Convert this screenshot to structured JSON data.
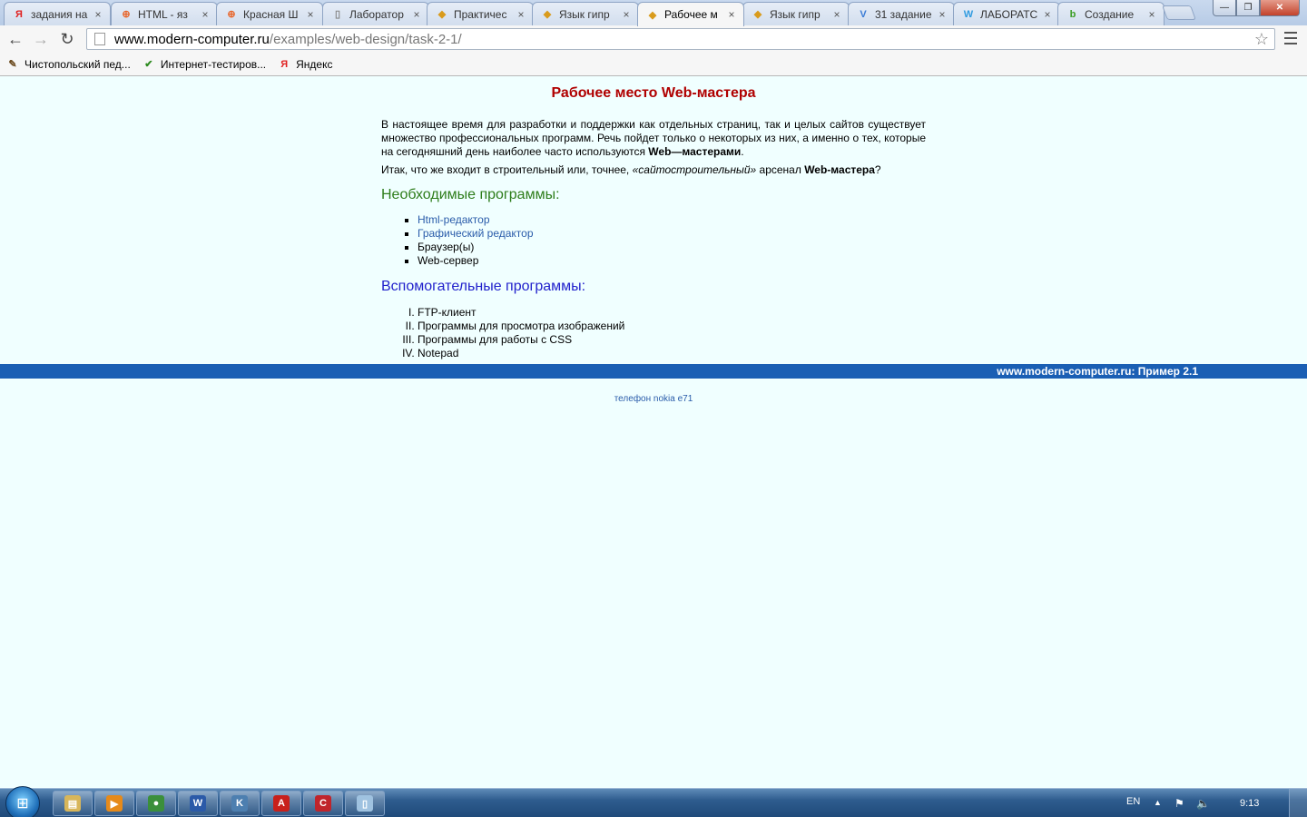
{
  "browser": {
    "tabs": [
      {
        "title": "задания на",
        "icon": "yandex-icon",
        "icon_char": "Я",
        "icon_color": "#e02020",
        "active": false
      },
      {
        "title": "HTML - яз",
        "icon": "lifebuoy-icon",
        "icon_char": "⊕",
        "icon_color": "#e8652a",
        "active": false
      },
      {
        "title": "Красная Ш",
        "icon": "lifebuoy-icon",
        "icon_char": "⊕",
        "icon_color": "#e8652a",
        "active": false
      },
      {
        "title": "Лаборатор",
        "icon": "blank-page-icon",
        "icon_char": "▯",
        "icon_color": "#888888",
        "active": false
      },
      {
        "title": "Практичес",
        "icon": "windows-logo-icon",
        "icon_char": "◆",
        "icon_color": "#d99b1c",
        "active": false
      },
      {
        "title": "Язык гипр",
        "icon": "windows-logo-icon",
        "icon_char": "◆",
        "icon_color": "#d99b1c",
        "active": false
      },
      {
        "title": "Рабочее м",
        "icon": "windows-logo-icon",
        "icon_char": "◆",
        "icon_color": "#d99b1c",
        "active": true
      },
      {
        "title": "Язык гипр",
        "icon": "windows-logo-icon",
        "icon_char": "◆",
        "icon_color": "#d99b1c",
        "active": false
      },
      {
        "title": "31 задание",
        "icon": "v-logo-icon",
        "icon_char": "V",
        "icon_color": "#3a7bd5",
        "active": false
      },
      {
        "title": "ЛАБОРАТС",
        "icon": "w-logo-icon",
        "icon_char": "W",
        "icon_color": "#2f9be0",
        "active": false
      },
      {
        "title": "Создание",
        "icon": "b-logo-icon",
        "icon_char": "b",
        "icon_color": "#3a9d23",
        "active": false
      }
    ],
    "tab_close_glyph": "×",
    "window_buttons": {
      "minimize": "—",
      "maximize": "❐",
      "close": "✕"
    },
    "nav": {
      "back": "←",
      "forward": "→",
      "reload": "↻"
    },
    "url": {
      "host": "www.modern-computer.ru",
      "path": "/examples/web-design/task-2-1/"
    },
    "bookmark_star": "☆",
    "bookmarks": [
      {
        "label": "Чистопольский пед...",
        "icon": "brush-icon",
        "icon_char": "✎",
        "icon_color": "#6b4a1e"
      },
      {
        "label": "Интернет-тестиров...",
        "icon": "green-check-icon",
        "icon_char": "✔",
        "icon_color": "#2d8a1f"
      },
      {
        "label": "Яндекс",
        "icon": "yandex-icon",
        "icon_char": "Я",
        "icon_color": "#e02020"
      }
    ]
  },
  "page": {
    "title": "Рабочее место Web-мастера",
    "intro_text": "В настоящее время для разработки и поддержки как отдельных страниц, так и целых сайтов существует множество профессиональных программ. Речь пойдет только о некоторых из них, а именно о тех, которые на сегодняшний день наиболее часто используются ",
    "intro_bold": "Web—мастерами",
    "intro_end": ".",
    "question_start": "Итак, что же входит в строительный или, точнее, ",
    "question_italic": "«сайтостроительный»",
    "question_mid": " арсенал ",
    "question_bold": "Web-мастера",
    "question_end": "?",
    "required_heading": "Необходимые программы:",
    "required_items": [
      {
        "label": "Html-редактор",
        "link": true
      },
      {
        "label": "Графический редактор",
        "link": true
      },
      {
        "label": "Браузер(ы)",
        "link": false
      },
      {
        "label": "Web-сервер",
        "link": false
      }
    ],
    "auxiliary_heading": "Вспомогательные программы:",
    "auxiliary_items": [
      "FTP-клиент",
      "Программы для просмотра изображений",
      "Программы для работы с CSS",
      "Notepad"
    ],
    "footer_bar_text": "www.modern-computer.ru: Пример 2.1",
    "footer_link": "телефон nokia e71"
  },
  "taskbar": {
    "apps": [
      {
        "name": "explorer-icon",
        "char": "▤",
        "color": "#d8b65a"
      },
      {
        "name": "media-player-icon",
        "char": "▶",
        "color": "#e68a1a"
      },
      {
        "name": "chrome-icon",
        "char": "●",
        "color": "#3b8f3b"
      },
      {
        "name": "word-icon",
        "char": "W",
        "color": "#2b5aa8"
      },
      {
        "name": "kaspersky-icon",
        "char": "K",
        "color": "#4d7fb0"
      },
      {
        "name": "acrobat-icon",
        "char": "A",
        "color": "#c8201b"
      },
      {
        "name": "red-app-icon",
        "char": "C",
        "color": "#c0242b"
      },
      {
        "name": "notepad-icon",
        "char": "▯",
        "color": "#9fc2e0"
      }
    ],
    "language": "EN",
    "clock": "9:13"
  },
  "colors": {
    "page_background": "#f0ffff",
    "title_red": "#b00000",
    "required_green": "#2e7d1b",
    "auxiliary_blue": "#2222cc",
    "footer_bar": "#1a5fb4",
    "link": "#2a5caa"
  }
}
